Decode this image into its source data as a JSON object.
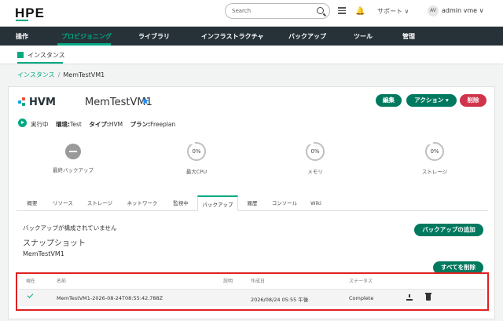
{
  "header": {
    "logo": "HPE",
    "search_placeholder": "Search",
    "support": "サポート ∨",
    "avatar": "AV",
    "user": "admin vme ∨"
  },
  "main_nav": [
    "操作",
    "プロビジョニング",
    "ライブラリ",
    "インフラストラクチャ",
    "バックアップ",
    "ツール",
    "管理"
  ],
  "sub_nav": {
    "instances": "インスタンス"
  },
  "breadcrumb": {
    "parent": "インスタンス",
    "separator": "/",
    "current": "MemTestVM1"
  },
  "instance": {
    "platform": "HVM",
    "name": "MemTestVM1",
    "favorite_icon": "★",
    "status": "実行中",
    "env_label": "環境:",
    "env_value": "Test",
    "type_label": "タイプ:",
    "type_value": "HVM",
    "plan_label": "プラン:",
    "plan_value": "Freeplan"
  },
  "actions": {
    "edit": "編集",
    "action": "アクション ▾",
    "delete": "削除"
  },
  "metrics": {
    "last_backup_label": "最終バックアップ",
    "cpu_value": "0%",
    "cpu_label": "最大CPU",
    "memory_value": "0%",
    "memory_label": "メモリ",
    "storage_value": "0%",
    "storage_label": "ストレージ"
  },
  "tabs": [
    "概要",
    "リソース",
    "ストレージ",
    "ネットワーク",
    "監視中",
    "バックアップ",
    "履歴",
    "コンソール",
    "Wiki"
  ],
  "backups": {
    "not_configured": "バックアップが構成されていません",
    "add_button": "バックアップの追加",
    "snapshot_heading": "スナップショット",
    "vm_name": "MemTestVM1",
    "delete_all_button": "すべてを削除",
    "columns": [
      "現在",
      "名前",
      "説明",
      "作成日",
      "ステータス"
    ],
    "rows": [
      {
        "name": "MemTestVM1-2026-08-24T08:55:42.788Z",
        "description": "",
        "created": "2026/08/24 05:55 午後",
        "status": "Complete"
      }
    ]
  },
  "colors": {
    "brand_green": "#01a982",
    "button_green": "#01795f",
    "delete_red": "#d0334a",
    "nav_dark": "#263238",
    "highlight_red": "#e02020"
  }
}
